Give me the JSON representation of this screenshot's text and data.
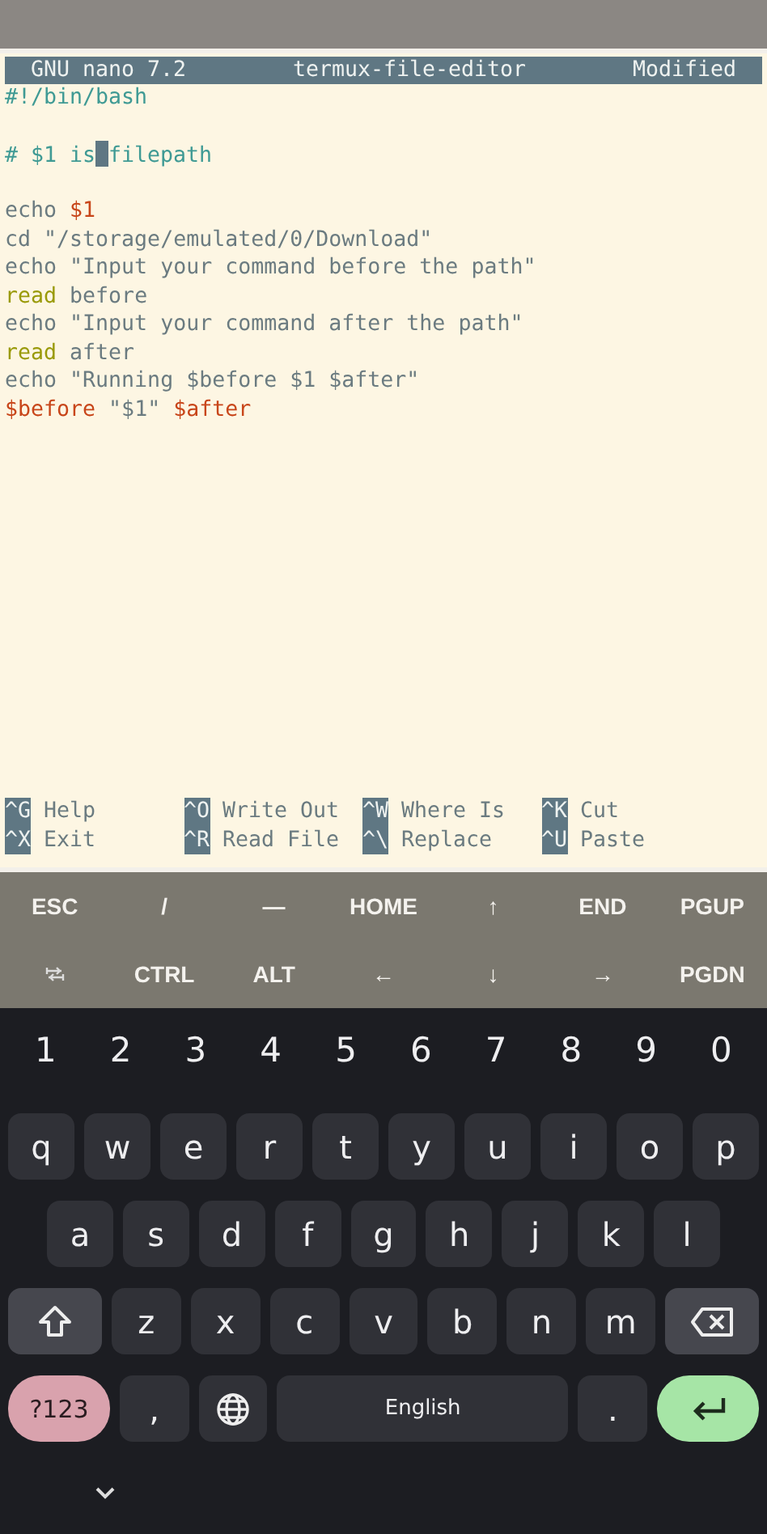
{
  "editor": {
    "title_bar": {
      "app": "GNU nano 7.2",
      "file": "termux-file-editor",
      "status": "Modified"
    },
    "lines": [
      {
        "kind": "code",
        "tokens": [
          {
            "text": "#!/bin/bash",
            "kind": "comment"
          }
        ]
      },
      {
        "kind": "blank"
      },
      {
        "kind": "code",
        "tokens": [
          {
            "text": "# $1 is",
            "kind": "comment"
          },
          {
            "kind": "cursor"
          },
          {
            "text": "filepath",
            "kind": "comment"
          }
        ]
      },
      {
        "kind": "blank"
      },
      {
        "kind": "code",
        "tokens": [
          {
            "text": "echo ",
            "kind": "plain"
          },
          {
            "text": "$1",
            "kind": "variable"
          }
        ]
      },
      {
        "kind": "code",
        "tokens": [
          {
            "text": "cd \"/storage/emulated/0/Download\"",
            "kind": "plain"
          }
        ]
      },
      {
        "kind": "code",
        "tokens": [
          {
            "text": "echo \"Input your command before the path\"",
            "kind": "plain"
          }
        ]
      },
      {
        "kind": "code",
        "tokens": [
          {
            "text": "read",
            "kind": "builtin"
          },
          {
            "text": " before",
            "kind": "plain"
          }
        ]
      },
      {
        "kind": "code",
        "tokens": [
          {
            "text": "echo \"Input your command after the path\"",
            "kind": "plain"
          }
        ]
      },
      {
        "kind": "code",
        "tokens": [
          {
            "text": "read",
            "kind": "builtin"
          },
          {
            "text": " after",
            "kind": "plain"
          }
        ]
      },
      {
        "kind": "code",
        "tokens": [
          {
            "text": "echo \"Running $before $1 $after\"",
            "kind": "plain"
          }
        ]
      },
      {
        "kind": "code",
        "tokens": [
          {
            "text": "$before",
            "kind": "variable"
          },
          {
            "text": " \"$1\" ",
            "kind": "plain"
          },
          {
            "text": "$after",
            "kind": "variable"
          }
        ]
      }
    ],
    "shortcuts": [
      [
        {
          "key": "^G",
          "label": "Help"
        },
        {
          "key": "^X",
          "label": "Exit"
        }
      ],
      [
        {
          "key": "^O",
          "label": "Write Out"
        },
        {
          "key": "^R",
          "label": "Read File"
        }
      ],
      [
        {
          "key": "^W",
          "label": "Where Is"
        },
        {
          "key": "^\\",
          "label": "Replace"
        }
      ],
      [
        {
          "key": "^K",
          "label": "Cut"
        },
        {
          "key": "^U",
          "label": "Paste"
        }
      ]
    ]
  },
  "extra_keys": [
    [
      {
        "kind": "text",
        "label": "ESC"
      },
      {
        "kind": "text",
        "label": "/"
      },
      {
        "kind": "text",
        "label": "—"
      },
      {
        "kind": "text",
        "label": "HOME"
      },
      {
        "kind": "text",
        "label": "↑"
      },
      {
        "kind": "text",
        "label": "END"
      },
      {
        "kind": "text",
        "label": "PGUP"
      }
    ],
    [
      {
        "kind": "tab"
      },
      {
        "kind": "text",
        "label": "CTRL"
      },
      {
        "kind": "text",
        "label": "ALT"
      },
      {
        "kind": "text",
        "label": "←"
      },
      {
        "kind": "text",
        "label": "↓"
      },
      {
        "kind": "text",
        "label": "→"
      },
      {
        "kind": "text",
        "label": "PGDN"
      }
    ]
  ],
  "keyboard": {
    "rows": [
      {
        "kind": "numbers",
        "keys": [
          {
            "label": "1"
          },
          {
            "label": "2"
          },
          {
            "label": "3"
          },
          {
            "label": "4"
          },
          {
            "label": "5"
          },
          {
            "label": "6"
          },
          {
            "label": "7"
          },
          {
            "label": "8"
          },
          {
            "label": "9"
          },
          {
            "label": "0"
          }
        ]
      },
      {
        "kind": "keys",
        "keys": [
          {
            "kind": "char",
            "label": "q"
          },
          {
            "kind": "char",
            "label": "w"
          },
          {
            "kind": "char",
            "label": "e"
          },
          {
            "kind": "char",
            "label": "r"
          },
          {
            "kind": "char",
            "label": "t"
          },
          {
            "kind": "char",
            "label": "y"
          },
          {
            "kind": "char",
            "label": "u"
          },
          {
            "kind": "char",
            "label": "i"
          },
          {
            "kind": "char",
            "label": "o"
          },
          {
            "kind": "char",
            "label": "p"
          }
        ]
      },
      {
        "kind": "keys",
        "keys": [
          {
            "kind": "char",
            "label": "a"
          },
          {
            "kind": "char",
            "label": "s"
          },
          {
            "kind": "char",
            "label": "d"
          },
          {
            "kind": "char",
            "label": "f"
          },
          {
            "kind": "char",
            "label": "g"
          },
          {
            "kind": "char",
            "label": "h"
          },
          {
            "kind": "char",
            "label": "j"
          },
          {
            "kind": "char",
            "label": "k"
          },
          {
            "kind": "char",
            "label": "l"
          }
        ]
      },
      {
        "kind": "keys",
        "keys": [
          {
            "kind": "shift"
          },
          {
            "kind": "char",
            "label": "z"
          },
          {
            "kind": "char",
            "label": "x"
          },
          {
            "kind": "char",
            "label": "c"
          },
          {
            "kind": "char",
            "label": "v"
          },
          {
            "kind": "char",
            "label": "b"
          },
          {
            "kind": "char",
            "label": "n"
          },
          {
            "kind": "char",
            "label": "m"
          },
          {
            "kind": "backspace"
          }
        ]
      },
      {
        "kind": "keys",
        "keys": [
          {
            "kind": "symbols",
            "label": "?123"
          },
          {
            "kind": "char",
            "label": ","
          },
          {
            "kind": "globe"
          },
          {
            "kind": "space",
            "label": "English"
          },
          {
            "kind": "char",
            "label": "."
          },
          {
            "kind": "enter"
          }
        ]
      }
    ]
  }
}
